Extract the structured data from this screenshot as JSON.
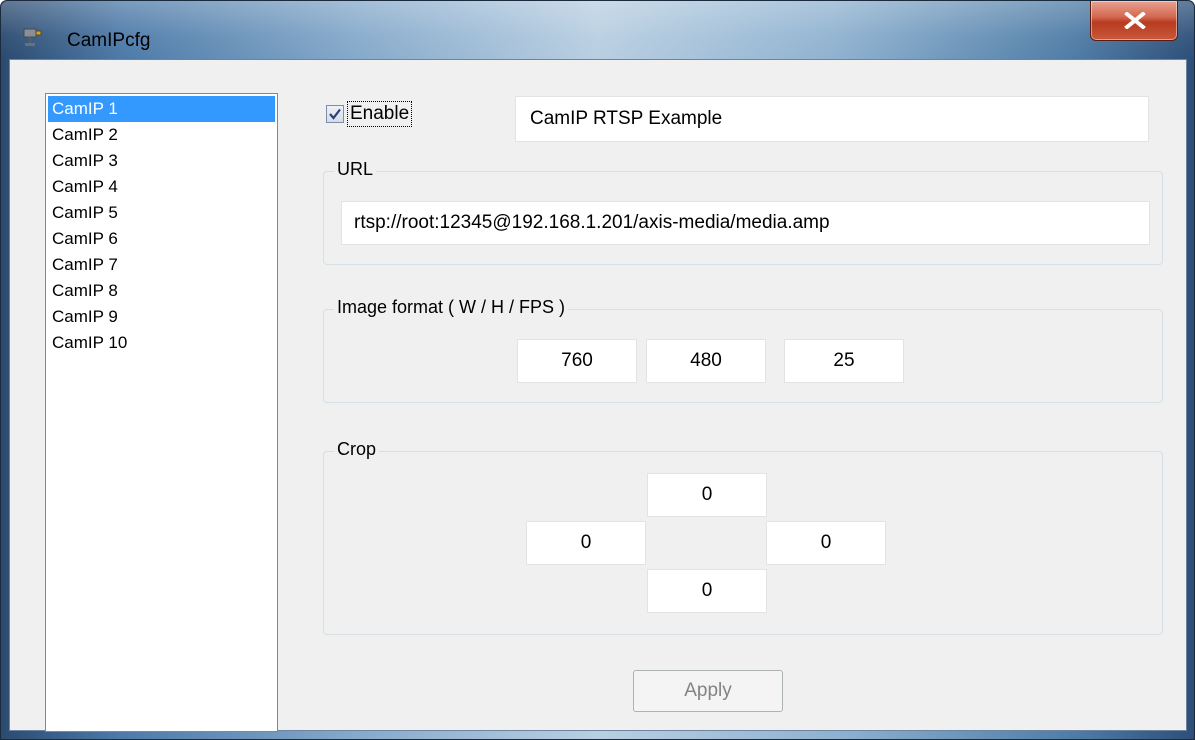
{
  "window": {
    "title": "CamIPcfg",
    "app_icon": "camera-icon",
    "close_icon": "close-x-icon"
  },
  "camera_list": {
    "items": [
      "CamIP 1",
      "CamIP 2",
      "CamIP 3",
      "CamIP 4",
      "CamIP 5",
      "CamIP 6",
      "CamIP 7",
      "CamIP 8",
      "CamIP 9",
      "CamIP 10"
    ],
    "selected": "CamIP 1"
  },
  "enable": {
    "label": "Enable",
    "checked": true
  },
  "camera_name": "CamIP RTSP Example",
  "url": {
    "legend": "URL",
    "value": "rtsp://root:12345@192.168.1.201/axis-media/media.amp"
  },
  "image_format": {
    "legend": "Image format ( W / H / FPS )",
    "width": "760",
    "height": "480",
    "fps": "25"
  },
  "crop": {
    "legend": "Crop",
    "top": "0",
    "left": "0",
    "right": "0",
    "bottom": "0"
  },
  "apply_button": "Apply",
  "colors": {
    "selection": "#3399ff",
    "dialog_background": "#f0f0f0",
    "close_button": "#c9452a"
  }
}
